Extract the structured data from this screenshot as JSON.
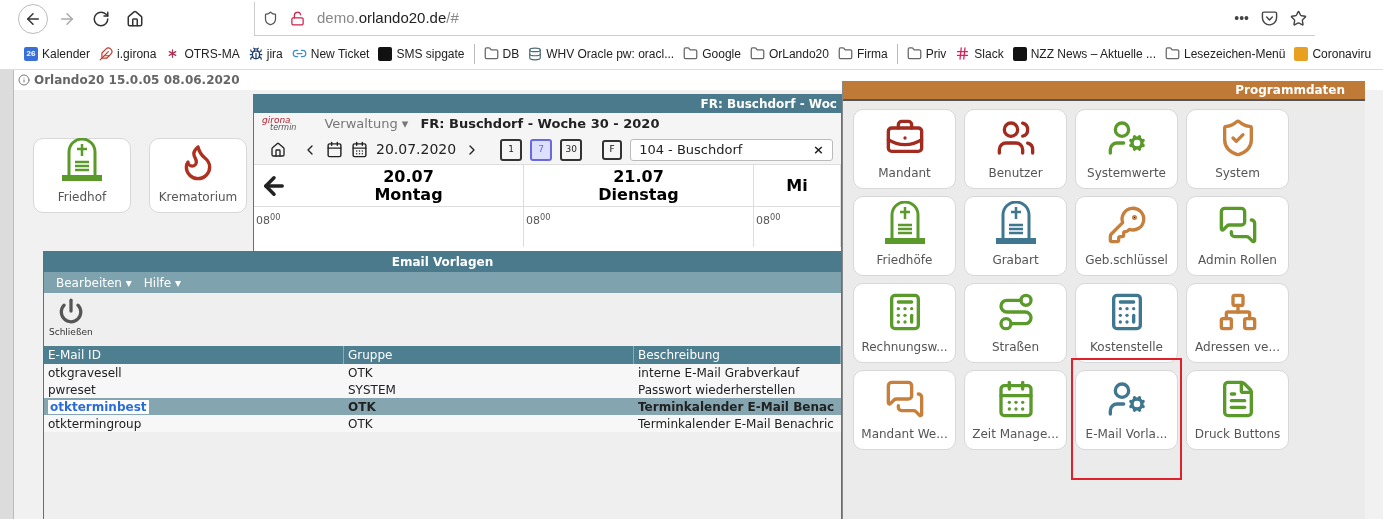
{
  "browser": {
    "nav": [
      {
        "kind": "back",
        "disabled": false
      },
      {
        "kind": "forward",
        "disabled": true
      },
      {
        "kind": "reload",
        "disabled": false
      },
      {
        "kind": "home",
        "disabled": false
      }
    ],
    "url": [
      {
        "text": "demo.",
        "muted": true
      },
      {
        "text": "orlando20.de",
        "muted": false
      },
      {
        "text": "/#",
        "muted": true
      }
    ],
    "actions": "•••",
    "bookmarks": [
      {
        "kind": "calendar",
        "label": "Kalender",
        "badge": "26"
      },
      {
        "kind": "site",
        "label": "i.girona"
      },
      {
        "kind": "star",
        "label": "OTRS-MA"
      },
      {
        "kind": "person",
        "label": "jira"
      },
      {
        "kind": "link",
        "label": "New Ticket"
      },
      {
        "kind": "dark",
        "label": "SMS sipgate"
      },
      {
        "kind": "separator"
      },
      {
        "kind": "folder",
        "label": "DB"
      },
      {
        "kind": "db",
        "label": "WHV Oracle pw: oracl..."
      },
      {
        "kind": "folder",
        "label": "Google"
      },
      {
        "kind": "folder",
        "label": "OrLando20"
      },
      {
        "kind": "folder",
        "label": "Firma"
      },
      {
        "kind": "separator"
      },
      {
        "kind": "folder",
        "label": "Priv"
      },
      {
        "kind": "slack",
        "label": "Slack"
      },
      {
        "kind": "dark",
        "label": "NZZ News – Aktuelle ..."
      },
      {
        "kind": "folder",
        "label": "Lesezeichen-Menü"
      },
      {
        "kind": "orange",
        "label": "Coronaviru"
      }
    ]
  },
  "app_version": "Orlando20 15.0.05 08.06.2020",
  "background_tiles": [
    {
      "label": "Friedhof",
      "kind": "grave",
      "color": "#5a9a2a"
    },
    {
      "label": "Krematorium",
      "kind": "flame",
      "color": "#b03020"
    }
  ],
  "calendar": {
    "title": "FR: Buschdorf - Woc",
    "logo": [
      "girona",
      "termin"
    ],
    "menu": {
      "label": "Verwaltung",
      "caret": "▾"
    },
    "heading": "FR: Buschdorf - Woche 30 - 2020",
    "date": "20.07.2020",
    "views": [
      {
        "label": "1",
        "selected": false
      },
      {
        "label": "7",
        "selected": true
      },
      {
        "label": "30",
        "selected": false
      }
    ],
    "filter_glyph": "F",
    "location": "104 - Buschdorf",
    "clear": "×",
    "days": [
      {
        "date": "20.07",
        "weekday": "Montag",
        "time": "08$^{00}$"
      },
      {
        "date": "21.07",
        "weekday": "Dienstag",
        "time": "08$^{00}$"
      },
      {
        "weekday": "Mi",
        "time": "08$^{00}$"
      }
    ]
  },
  "email_window": {
    "title": "Email Vorlagen",
    "menus": [
      {
        "label": "Bearbeiten",
        "caret": "▾"
      },
      {
        "label": "Hilfe",
        "caret": "▾"
      }
    ],
    "close_label": "Schließen",
    "columns": [
      "E-Mail ID",
      "Gruppe",
      "Beschreibung"
    ],
    "rows": [
      {
        "cells": [
          "otkgravesell",
          "OTK",
          "interne E-Mail Grabverkauf"
        ],
        "selected": false
      },
      {
        "cells": [
          "pwreset",
          "SYSTEM",
          "Passwort wiederherstellen"
        ],
        "selected": false
      },
      {
        "cells": [
          "otkterminbest",
          "OTK",
          "Terminkalender E-Mail Benac"
        ],
        "selected": true
      },
      {
        "cells": [
          "otktermingroup",
          "OTK",
          "Terminkalender E-Mail Benachric"
        ],
        "selected": false
      }
    ]
  },
  "program_data": {
    "title": "Programmdaten",
    "tiles": [
      {
        "label": "Mandant",
        "kind": "manager",
        "color": "#a12b1e",
        "highlighted": false
      },
      {
        "label": "Benutzer",
        "kind": "users",
        "color": "#a12b1e",
        "highlighted": false
      },
      {
        "label": "Systemwerte",
        "kind": "exchange",
        "color": "#5a9a2a",
        "highlighted": false
      },
      {
        "label": "System",
        "kind": "shield",
        "color": "#c77f3c",
        "highlighted": false
      },
      {
        "label": "Friedhöfe",
        "kind": "grave",
        "color": "#5a9a2a",
        "highlighted": false
      },
      {
        "label": "Grabart",
        "kind": "grave",
        "color": "#3f7690",
        "highlighted": false
      },
      {
        "label": "Geb.schlüssel",
        "kind": "keys",
        "color": "#c77f3c",
        "highlighted": false
      },
      {
        "label": "Admin Rollen",
        "kind": "chat",
        "color": "#5a9a2a",
        "highlighted": false
      },
      {
        "label": "Rechnungsw...",
        "kind": "register",
        "color": "#5a9a2a",
        "highlighted": false
      },
      {
        "label": "Straßen",
        "kind": "road",
        "color": "#5a9a2a",
        "highlighted": false
      },
      {
        "label": "Kostenstelle",
        "kind": "register",
        "color": "#3f7690",
        "highlighted": false
      },
      {
        "label": "Adressen ve...",
        "kind": "network",
        "color": "#c77f3c",
        "highlighted": false
      },
      {
        "label": "Mandant We...",
        "kind": "chat",
        "color": "#c77f3c",
        "highlighted": false
      },
      {
        "label": "Zeit Manage...",
        "kind": "calendar",
        "color": "#5a9a2a",
        "highlighted": false
      },
      {
        "label": "E-Mail Vorla...",
        "kind": "exchange",
        "color": "#3f7690",
        "highlighted": true
      },
      {
        "label": "Druck Buttons",
        "kind": "document",
        "color": "#5a9a2a",
        "highlighted": false
      }
    ]
  }
}
